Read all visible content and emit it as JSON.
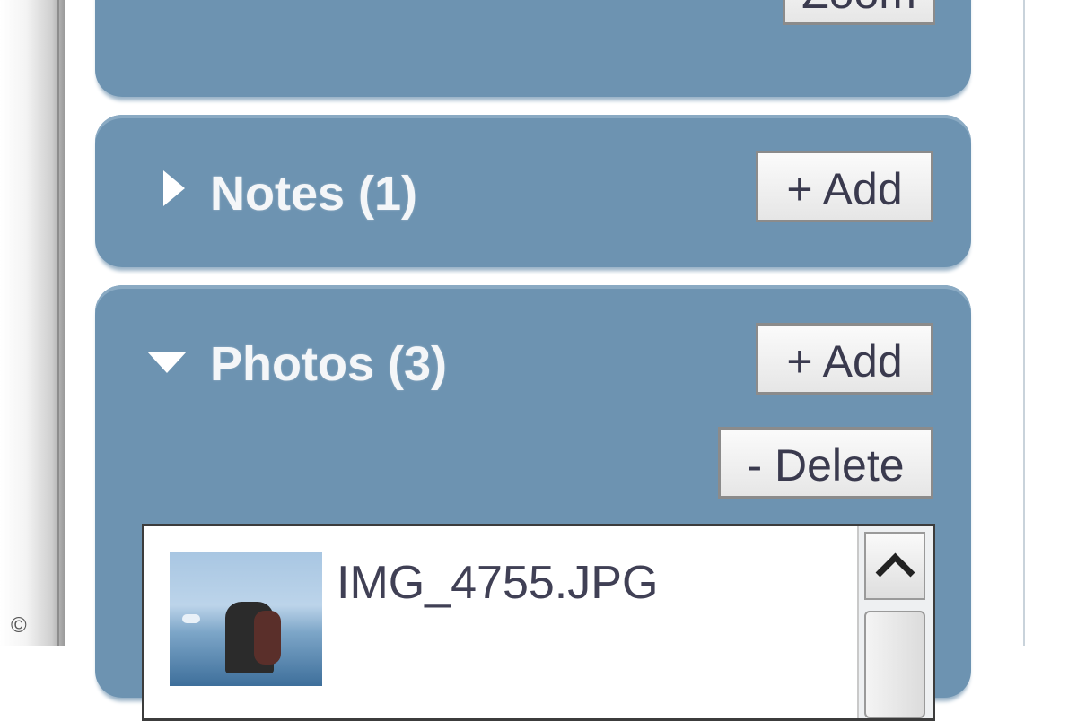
{
  "zoom_panel": {
    "zoom_label": "Zoom"
  },
  "notes": {
    "title": "Notes (1)",
    "add_label": "+ Add"
  },
  "photos": {
    "title": "Photos (3)",
    "add_label": "+ Add",
    "delete_label": "- Delete",
    "items": [
      {
        "filename": "IMG_4755.JPG"
      }
    ]
  },
  "footer": {
    "copyright": "©"
  },
  "icons": {
    "notes_toggle": "caret-right-icon",
    "photos_toggle": "caret-down-icon",
    "scroll_up": "chevron-up-icon"
  },
  "colors": {
    "panel": "#6d93b1",
    "button_text": "#3a3a4e",
    "title_text": "#f4f6f8"
  }
}
